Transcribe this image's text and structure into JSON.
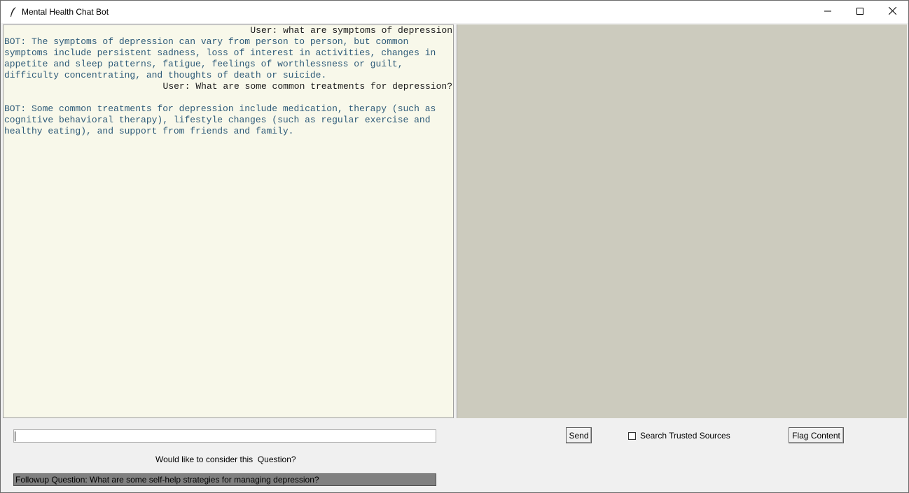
{
  "window": {
    "title": "Mental Health Chat Bot"
  },
  "chat": {
    "messages": [
      {
        "role": "user",
        "text": "User: what are symptoms of depression"
      },
      {
        "role": "bot",
        "text": "BOT: The symptoms of depression can vary from person to person, but common\nsymptoms include persistent sadness, loss of interest in activities, changes in\nappetite and sleep patterns, fatigue, feelings of worthlessness or guilt,\ndifficulty concentrating, and thoughts of death or suicide."
      },
      {
        "role": "user",
        "text": "User: What are some common treatments for depression?"
      },
      {
        "role": "bot",
        "text": "BOT: Some common treatments for depression include medication, therapy (such as\ncognitive behavioral therapy), lifestyle changes (such as regular exercise and\nhealthy eating), and support from friends and family."
      }
    ]
  },
  "input": {
    "value": ""
  },
  "buttons": {
    "send": "Send",
    "flag": "Flag Content"
  },
  "search_trusted": {
    "label": "Search Trusted Sources",
    "checked": false
  },
  "followup": {
    "prompt": "Would like to consider this  Question?",
    "question": "Followup Question: What are some self-help strategies for managing depression?"
  },
  "colors": {
    "chat_bg": "#f8f8ea",
    "bot_text": "#2d5a78",
    "right_panel_bg": "#cccbbe",
    "followup_bg": "#808080"
  },
  "icons": {
    "app": "feather-icon",
    "minimize": "minimize-icon",
    "maximize": "maximize-icon",
    "close": "close-icon"
  }
}
